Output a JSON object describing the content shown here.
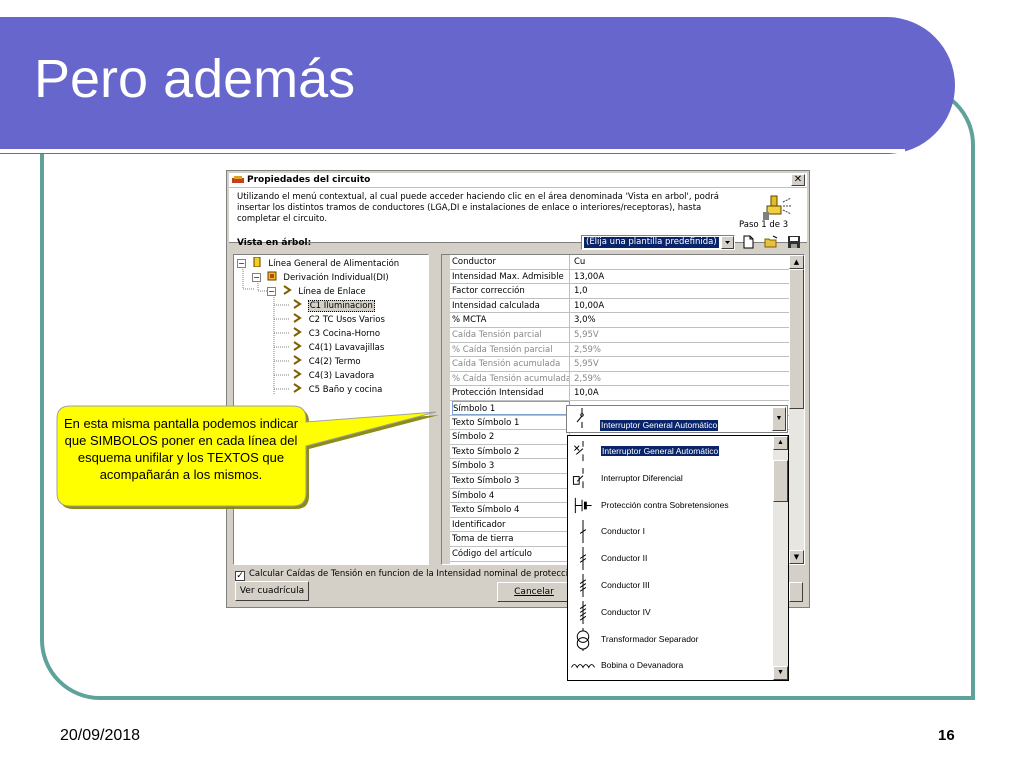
{
  "slide": {
    "title": "Pero además",
    "date": "20/09/2018",
    "page_number": "16"
  },
  "dialog": {
    "title": "Propiedades del circuito",
    "close_label": "✕",
    "description": "Utilizando el menú contextual, al cual puede acceder haciendo clic en el área denominada 'Vista en arbol', podrá insertar los distintos tramos de conductores (LGA,DI e instalaciones de enlace o interiores/receptoras), hasta completar el circuito.",
    "step": "Paso 1 de 3",
    "tree_label": "Vista en árbol:",
    "template_select_value": "(Elija una plantilla predefinida)",
    "tree": [
      {
        "label": "Línea General de Alimentación",
        "expander": "−"
      },
      {
        "label": "Derivación Individual(DI)",
        "expander": "−"
      },
      {
        "label": "Línea de Enlace",
        "expander": "−"
      },
      {
        "label": "C1 Iluminacion",
        "selected": true
      },
      {
        "label": "C2 TC Usos Varios"
      },
      {
        "label": "C3 Cocina-Horno"
      },
      {
        "label": "C4(1) Lavavajillas"
      },
      {
        "label": "C4(2) Termo"
      },
      {
        "label": "C4(3) Lavadora"
      },
      {
        "label": "C5 Baño y cocina"
      }
    ],
    "properties": [
      {
        "key": "Conductor",
        "value": "Cu"
      },
      {
        "key": "Intensidad Max. Admisible",
        "value": "13,00A"
      },
      {
        "key": "Factor corrección",
        "value": "1,0"
      },
      {
        "key": "Intensidad calculada",
        "value": "10,00A"
      },
      {
        "key": "% MCTA",
        "value": "3,0%"
      },
      {
        "key": "Caída Tensión parcial",
        "value": "5,95V",
        "dim": true
      },
      {
        "key": "% Caída Tensión parcial",
        "value": "2,59%",
        "dim": true
      },
      {
        "key": "Caída Tensión acumulada",
        "value": "5,95V",
        "dim": true
      },
      {
        "key": "% Caída Tensión acumulada",
        "value": "2,59%",
        "dim": true
      },
      {
        "key": "Protección Intensidad",
        "value": "10,0A"
      },
      {
        "key": "Símbolo 1",
        "value": "",
        "active": true
      },
      {
        "key": "Texto Símbolo 1",
        "value": ""
      },
      {
        "key": "Símbolo 2",
        "value": ""
      },
      {
        "key": "Texto Símbolo 2",
        "value": ""
      },
      {
        "key": "Símbolo 3",
        "value": ""
      },
      {
        "key": "Texto Símbolo 3",
        "value": ""
      },
      {
        "key": "Símbolo 4",
        "value": ""
      },
      {
        "key": "Texto Símbolo 4",
        "value": ""
      },
      {
        "key": "Identificador",
        "value": ""
      },
      {
        "key": "Toma de tierra",
        "value": ""
      },
      {
        "key": "Código del artículo",
        "value": ""
      }
    ],
    "checkbox_label": "Calcular Caídas de Tensión en funcion de la Intensidad nominal de protección",
    "checkbox_checked": "✓",
    "grid_button": "Ver cuadrícula",
    "cancel_button": "Cancelar",
    "combo_value": "Interruptor General Automático",
    "symbol_options": [
      {
        "label": "Interruptor General Automático",
        "selected": true,
        "icon": "breaker-icon"
      },
      {
        "label": "Interruptor Diferencial",
        "icon": "differential-icon"
      },
      {
        "label": "Protección contra Sobretensiones",
        "icon": "surge-icon"
      },
      {
        "label": "Conductor I",
        "icon": "conductor-1-icon"
      },
      {
        "label": "Conductor II",
        "icon": "conductor-2-icon"
      },
      {
        "label": "Conductor III",
        "icon": "conductor-3-icon"
      },
      {
        "label": "Conductor IV",
        "icon": "conductor-4-icon"
      },
      {
        "label": "Transformador Separador",
        "icon": "transformer-icon"
      },
      {
        "label": "Bobina o Devanadora",
        "icon": "coil-icon"
      }
    ]
  },
  "callout": {
    "text": "En esta misma pantalla podemos indicar que SIMBOLOS poner en cada línea del esquema unifilar y los TEXTOS que acompañarán a los mismos."
  },
  "colors": {
    "title_bar": "#6666cc",
    "frame_border": "#5fa29a",
    "callout_fill": "#ffff00",
    "selection": "#0a246a"
  }
}
